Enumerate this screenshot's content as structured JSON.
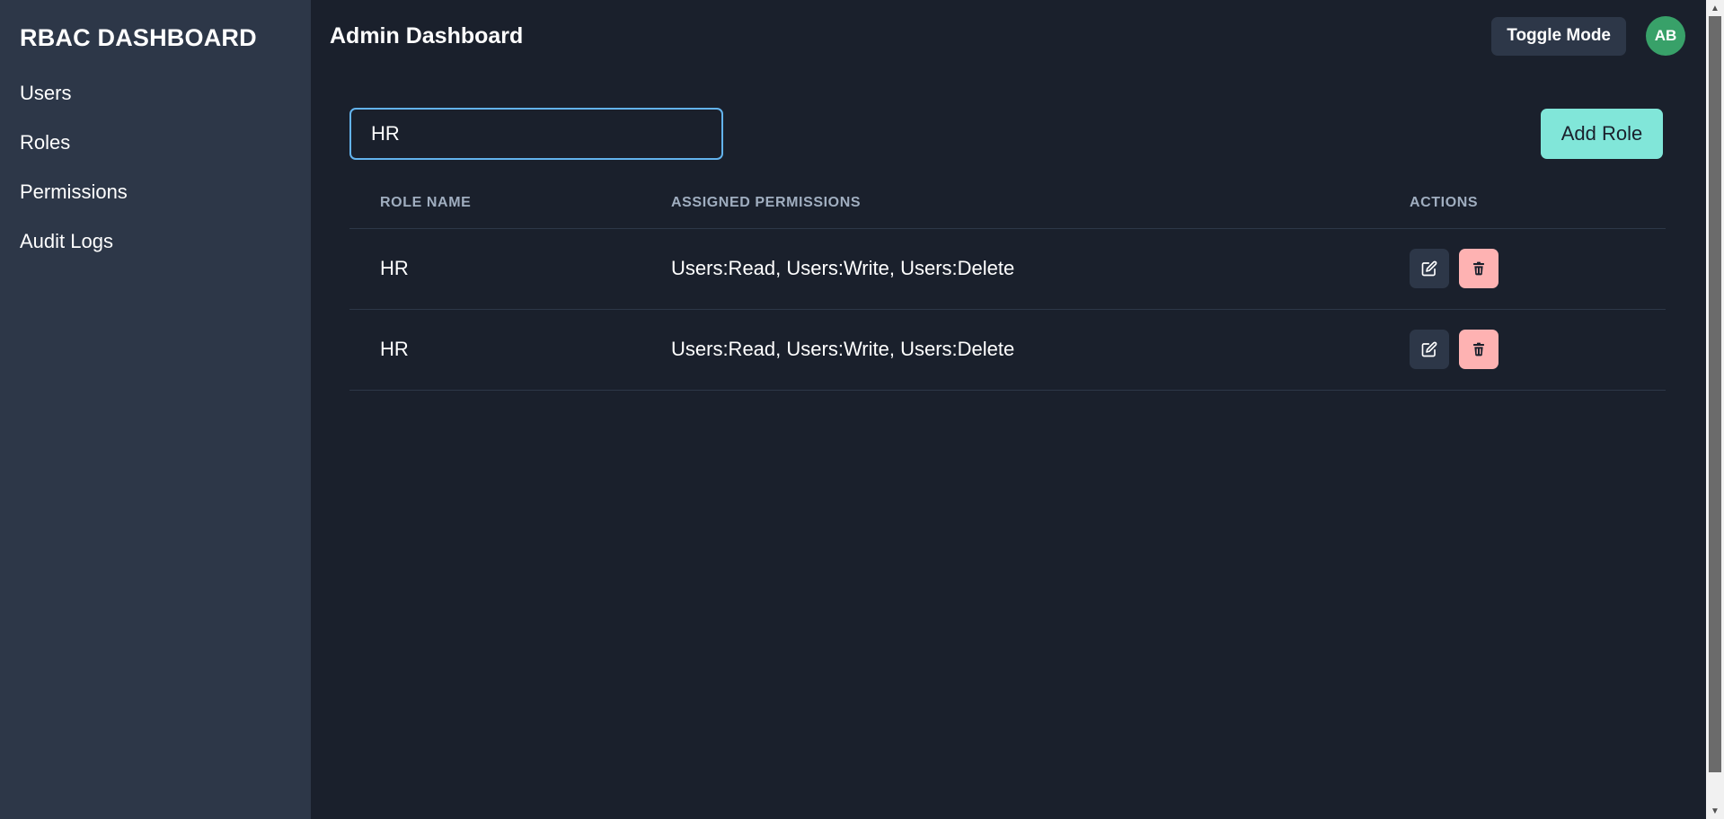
{
  "sidebar": {
    "brand": "RBAC DASHBOARD",
    "items": [
      {
        "label": "Users"
      },
      {
        "label": "Roles"
      },
      {
        "label": "Permissions"
      },
      {
        "label": "Audit Logs"
      }
    ]
  },
  "header": {
    "title": "Admin Dashboard",
    "toggle_label": "Toggle Mode",
    "avatar_initials": "AB"
  },
  "roles": {
    "search_value": "HR",
    "add_label": "Add Role",
    "columns": [
      "ROLE NAME",
      "ASSIGNED PERMISSIONS",
      "ACTIONS"
    ],
    "rows": [
      {
        "name": "HR",
        "permissions": "Users:Read, Users:Write, Users:Delete"
      },
      {
        "name": "HR",
        "permissions": "Users:Read, Users:Write, Users:Delete"
      }
    ]
  },
  "icons": {
    "edit": "edit-icon",
    "delete": "trash-icon"
  },
  "colors": {
    "background": "#1a202c",
    "sidebar": "#2d3748",
    "accent": "#81e6d9",
    "focus": "#63b3ed",
    "avatar": "#38a169",
    "danger": "#feb2b2"
  }
}
